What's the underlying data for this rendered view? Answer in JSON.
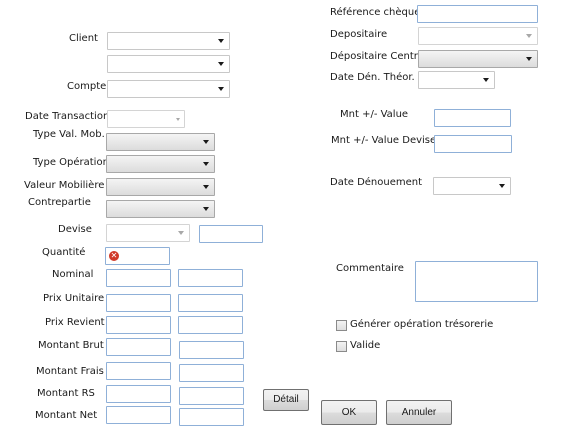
{
  "left": {
    "client_label": "Client",
    "compte_label": "Compte",
    "date_transaction_label": "Date Transaction",
    "type_val_mob_label": "Type Val. Mob.",
    "type_operation_label": "Type Opération",
    "valeur_mobiliere_label": "Valeur Mobilière",
    "contrepartie_label": "Contrepartie",
    "devise_label": "Devise",
    "quantite_label": "Quantité",
    "nominal_label": "Nominal",
    "prix_unitaire_label": "Prix Unitaire",
    "prix_revient_label": "Prix Revient",
    "montant_brut_label": "Montant Brut",
    "montant_frais_label": "Montant Frais",
    "montant_rs_label": "Montant RS",
    "montant_net_label": "Montant Net",
    "detail_button": "Détail"
  },
  "right": {
    "reference_cheque_label": "Référence chèque",
    "depositaire_label": "Depositaire",
    "depositaire_central_label": "Dépositaire Central",
    "date_den_theor_label": "Date Dén. Théor.",
    "mnt_value_label": "Mnt +/- Value",
    "mnt_value_devise_label": "Mnt +/- Value Devise",
    "date_denouement_label": "Date Dénouement",
    "commentaire_label": "Commentaire",
    "generer_operation_label": "Générer opération trésorerie",
    "valide_label": "Valide"
  },
  "actions": {
    "ok_button": "OK",
    "annuler_button": "Annuler"
  },
  "icons": {
    "validation_error": "error-x-icon",
    "dropdown": "chevron-down-icon"
  },
  "colors": {
    "input_border": "#8fb0d8",
    "error_icon": "#d03a2a"
  }
}
